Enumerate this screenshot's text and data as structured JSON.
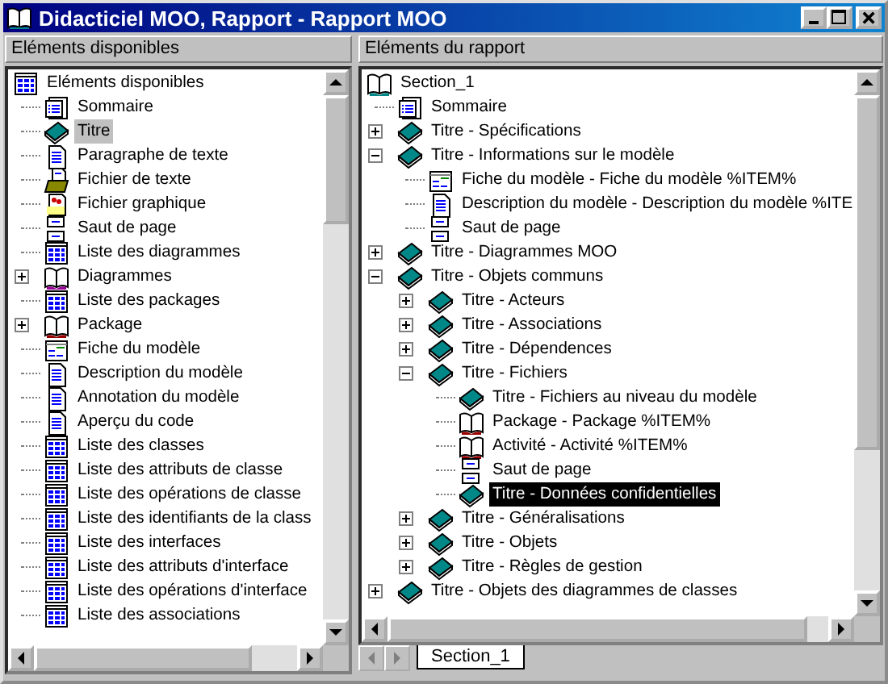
{
  "window": {
    "title": "Didacticiel MOO, Rapport - Rapport MOO"
  },
  "left_panel": {
    "header": "Eléments disponibles",
    "tree": [
      {
        "label": "Eléments disponibles",
        "kind": "list",
        "selected": false,
        "children": [
          {
            "label": "Sommaire",
            "kind": "summary",
            "selected": false
          },
          {
            "label": "Titre",
            "kind": "book",
            "selected": true
          },
          {
            "label": "Paragraphe de texte",
            "kind": "doc",
            "selected": false
          },
          {
            "label": "Fichier de texte",
            "kind": "textfile",
            "selected": false
          },
          {
            "label": "Fichier graphique",
            "kind": "graphic",
            "selected": false
          },
          {
            "label": "Saut de page",
            "kind": "pagebreak",
            "selected": false
          },
          {
            "label": "Liste des diagrammes",
            "kind": "list",
            "selected": false
          },
          {
            "label": "Diagrammes",
            "kind": "diagrams",
            "selected": false,
            "expanded": false
          },
          {
            "label": "Liste des packages",
            "kind": "list",
            "selected": false
          },
          {
            "label": "Package",
            "kind": "package",
            "selected": false,
            "expanded": false
          },
          {
            "label": "Fiche du modèle",
            "kind": "form",
            "selected": false
          },
          {
            "label": "Description du modèle",
            "kind": "doc",
            "selected": false
          },
          {
            "label": "Annotation du modèle",
            "kind": "doc",
            "selected": false
          },
          {
            "label": "Aperçu du code",
            "kind": "doc",
            "selected": false
          },
          {
            "label": "Liste des classes",
            "kind": "list",
            "selected": false
          },
          {
            "label": "Liste des attributs de classe",
            "kind": "list",
            "selected": false
          },
          {
            "label": "Liste des opérations de classe",
            "kind": "list",
            "selected": false
          },
          {
            "label": "Liste des identifiants de la class",
            "kind": "list",
            "selected": false
          },
          {
            "label": "Liste des interfaces",
            "kind": "list",
            "selected": false
          },
          {
            "label": "Liste des attributs d'interface",
            "kind": "list",
            "selected": false
          },
          {
            "label": "Liste des opérations d'interface",
            "kind": "list",
            "selected": false
          },
          {
            "label": "Liste des associations",
            "kind": "list",
            "selected": false
          }
        ]
      }
    ]
  },
  "right_panel": {
    "header": "Eléments du rapport",
    "tree": [
      {
        "label": "Section_1",
        "kind": "section",
        "selected": false,
        "children": [
          {
            "label": "Sommaire",
            "kind": "summary",
            "selected": false
          },
          {
            "label": "Titre - Spécifications",
            "kind": "book",
            "selected": false,
            "expanded": false
          },
          {
            "label": "Titre - Informations sur le modèle",
            "kind": "book",
            "selected": false,
            "expanded": true,
            "children": [
              {
                "label": "Fiche du modèle - Fiche du modèle %ITEM%",
                "kind": "form",
                "selected": false
              },
              {
                "label": "Description du modèle - Description du modèle %ITE",
                "kind": "doc",
                "selected": false
              },
              {
                "label": "Saut de page",
                "kind": "pagebreak",
                "selected": false
              }
            ]
          },
          {
            "label": "Titre - Diagrammes MOO",
            "kind": "book",
            "selected": false,
            "expanded": false
          },
          {
            "label": "Titre - Objets communs",
            "kind": "book",
            "selected": false,
            "expanded": true,
            "children": [
              {
                "label": "Titre - Acteurs",
                "kind": "book",
                "selected": false,
                "expanded": false
              },
              {
                "label": "Titre - Associations",
                "kind": "book",
                "selected": false,
                "expanded": false
              },
              {
                "label": "Titre - Dépendences",
                "kind": "book",
                "selected": false,
                "expanded": false
              },
              {
                "label": "Titre - Fichiers",
                "kind": "book",
                "selected": false,
                "expanded": true,
                "children": [
                  {
                    "label": "Titre - Fichiers au niveau du modèle",
                    "kind": "book",
                    "selected": false
                  },
                  {
                    "label": "Package - Package %ITEM%",
                    "kind": "package",
                    "selected": false
                  },
                  {
                    "label": "Activité - Activité %ITEM%",
                    "kind": "package",
                    "selected": false
                  },
                  {
                    "label": "Saut de page",
                    "kind": "pagebreak",
                    "selected": false
                  },
                  {
                    "label": "Titre - Données confidentielles",
                    "kind": "book",
                    "selected": true
                  }
                ]
              },
              {
                "label": "Titre - Généralisations",
                "kind": "book",
                "selected": false,
                "expanded": false
              },
              {
                "label": "Titre - Objets",
                "kind": "book",
                "selected": false,
                "expanded": false
              },
              {
                "label": "Titre - Règles de gestion",
                "kind": "book",
                "selected": false,
                "expanded": false
              }
            ]
          },
          {
            "label": "Titre - Objets des diagrammes de classes",
            "kind": "book",
            "selected": false,
            "expanded": false
          }
        ]
      }
    ],
    "tabs": [
      {
        "label": "Section_1",
        "selected": true
      }
    ]
  }
}
